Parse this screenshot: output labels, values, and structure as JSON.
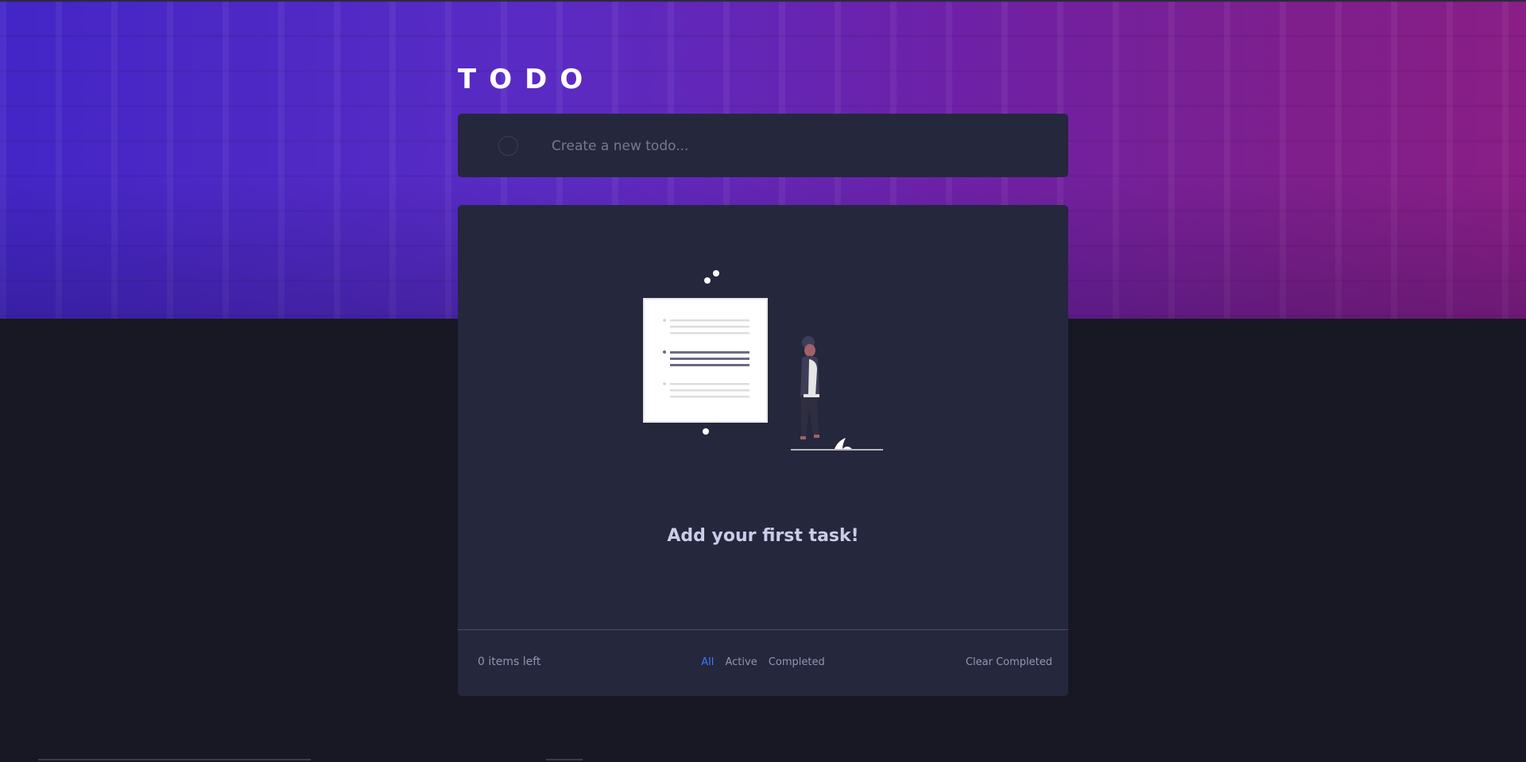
{
  "app": {
    "title": "TODO"
  },
  "new_todo": {
    "placeholder": "Create a new todo..."
  },
  "list": {
    "empty_message": "Add your first task!"
  },
  "footer": {
    "items_left": "0 items left",
    "filters": [
      "All",
      "Active",
      "Completed"
    ],
    "active_filter": "All",
    "clear_label": "Clear Completed"
  },
  "colors": {
    "accent": "#3a7cfd",
    "card": "#25273d",
    "page_bg": "#181824"
  }
}
